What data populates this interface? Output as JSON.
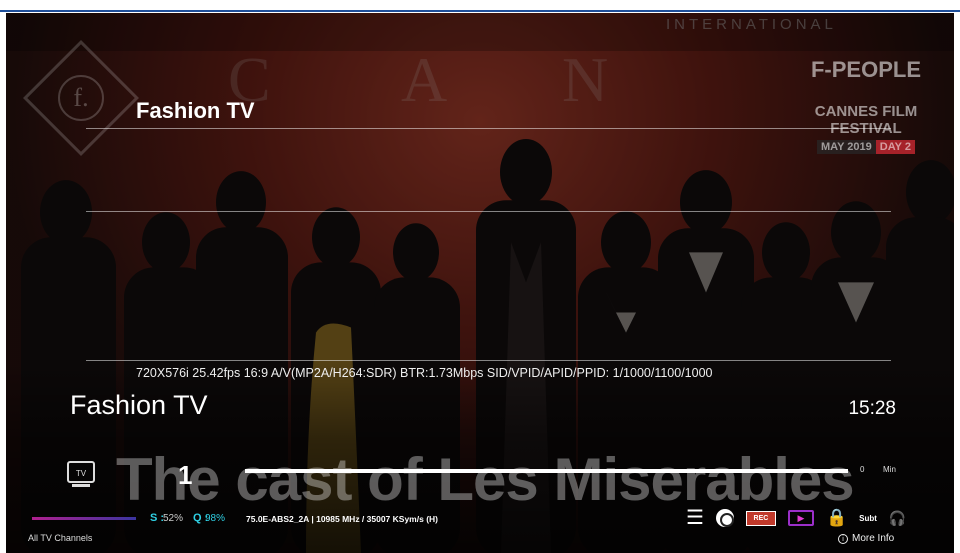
{
  "channel": {
    "name_top": "Fashion TV",
    "name": "Fashion TV",
    "number": "1",
    "tech_info": "720X576i 25.42fps 16:9 A/V(MP2A/H264:SDR) BTR:1.73Mbps SID/VPID/APID/PPID: 1/1000/1100/1000",
    "clock": "15:28",
    "group": "All TV Channels"
  },
  "epg": {
    "progress_fraction": 1.0,
    "remaining": "0",
    "unit": "Min"
  },
  "video": {
    "ticker_text": "The cast of Les Miserables",
    "intl_text": "INTERNATIONAL",
    "bg_letters": [
      "C",
      "A",
      "N"
    ],
    "logo_letter": "f.",
    "brand": "F-PEOPLE",
    "event": "CANNES FILM FESTIVAL",
    "date_month": "MAY 2019",
    "date_day": "DAY 2"
  },
  "signal": {
    "s_label": "S :",
    "s_value": "52%",
    "q_label": "Q :",
    "q_value": "98%",
    "transponder": "75.0E-ABS2_2A | 10985 MHz / 35007 KSym/s (H)"
  },
  "icons": {
    "tv_label": "TV",
    "rec_label": "REC",
    "subt_label": "Subt"
  },
  "footer": {
    "more_info": "More Info"
  },
  "colors": {
    "signal_accent": "#2fd0e4",
    "rec": "#c0392b",
    "media": "#9b2fc9"
  }
}
